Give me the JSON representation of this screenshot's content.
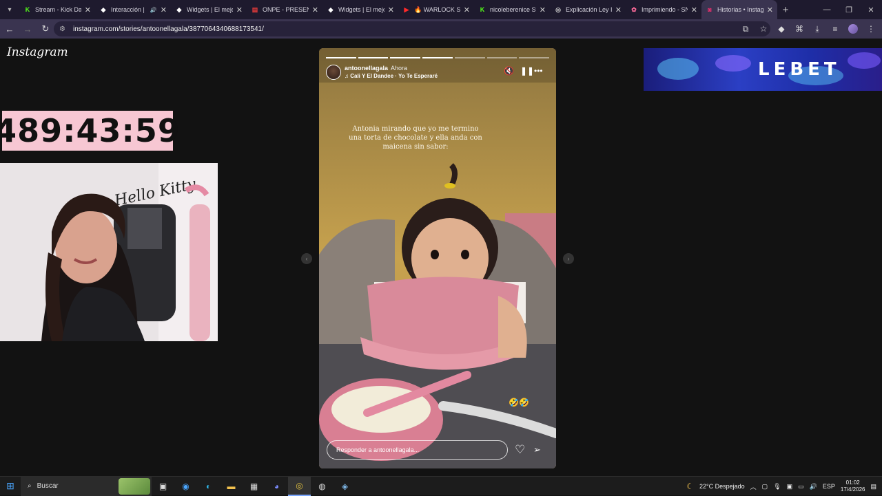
{
  "browser": {
    "tabs": [
      {
        "title": "Stream - Kick Das",
        "favicon_color": "#53fc18",
        "favicon": "K"
      },
      {
        "title": "Interacción | L",
        "favicon_color": "#ffffff",
        "favicon": "◆",
        "audio": true
      },
      {
        "title": "Widgets | El mejo",
        "favicon_color": "#ffffff",
        "favicon": "◆"
      },
      {
        "title": "ONPE - PRESENTA",
        "favicon_color": "#e23a3a",
        "favicon": "▤"
      },
      {
        "title": "Widgets | El mejo",
        "favicon_color": "#ffffff",
        "favicon": "◆"
      },
      {
        "title": "🔥 WARLOCK Sup",
        "favicon_color": "#ff2a2a",
        "favicon": "▶"
      },
      {
        "title": "nicoleberenice St",
        "favicon_color": "#53fc18",
        "favicon": "K"
      },
      {
        "title": "Explicación Ley In",
        "favicon_color": "#d0d0d0",
        "favicon": "◎"
      },
      {
        "title": "Imprimiendo - SN",
        "favicon_color": "#ff6b9a",
        "favicon": "✿"
      },
      {
        "title": "Historias • Instag",
        "favicon_color": "#e1306c",
        "favicon": "◙",
        "active": true
      }
    ],
    "url": "instagram.com/stories/antoonellagala/3877064340688173541/"
  },
  "page": {
    "logo": "Instagram",
    "timer": "489:43:59",
    "banner_text": "LEBET"
  },
  "story": {
    "username": "antoonellagala",
    "time": "Ahora",
    "song": "Cali Y El Dandee · Yo Te Esperaré",
    "caption": "Antonia mirando que yo me termino una torta de chocolate y ella anda con maicena sin sabor:",
    "emojis": "🤣🤣",
    "reply_placeholder": "Responder a antoonellagala...",
    "progress_total": 7,
    "progress_done": 4
  },
  "taskbar": {
    "search_label": "Buscar",
    "weather": "22°C  Despejado",
    "lang": "ESP",
    "time": "01:02",
    "date": "17/4/2026"
  }
}
